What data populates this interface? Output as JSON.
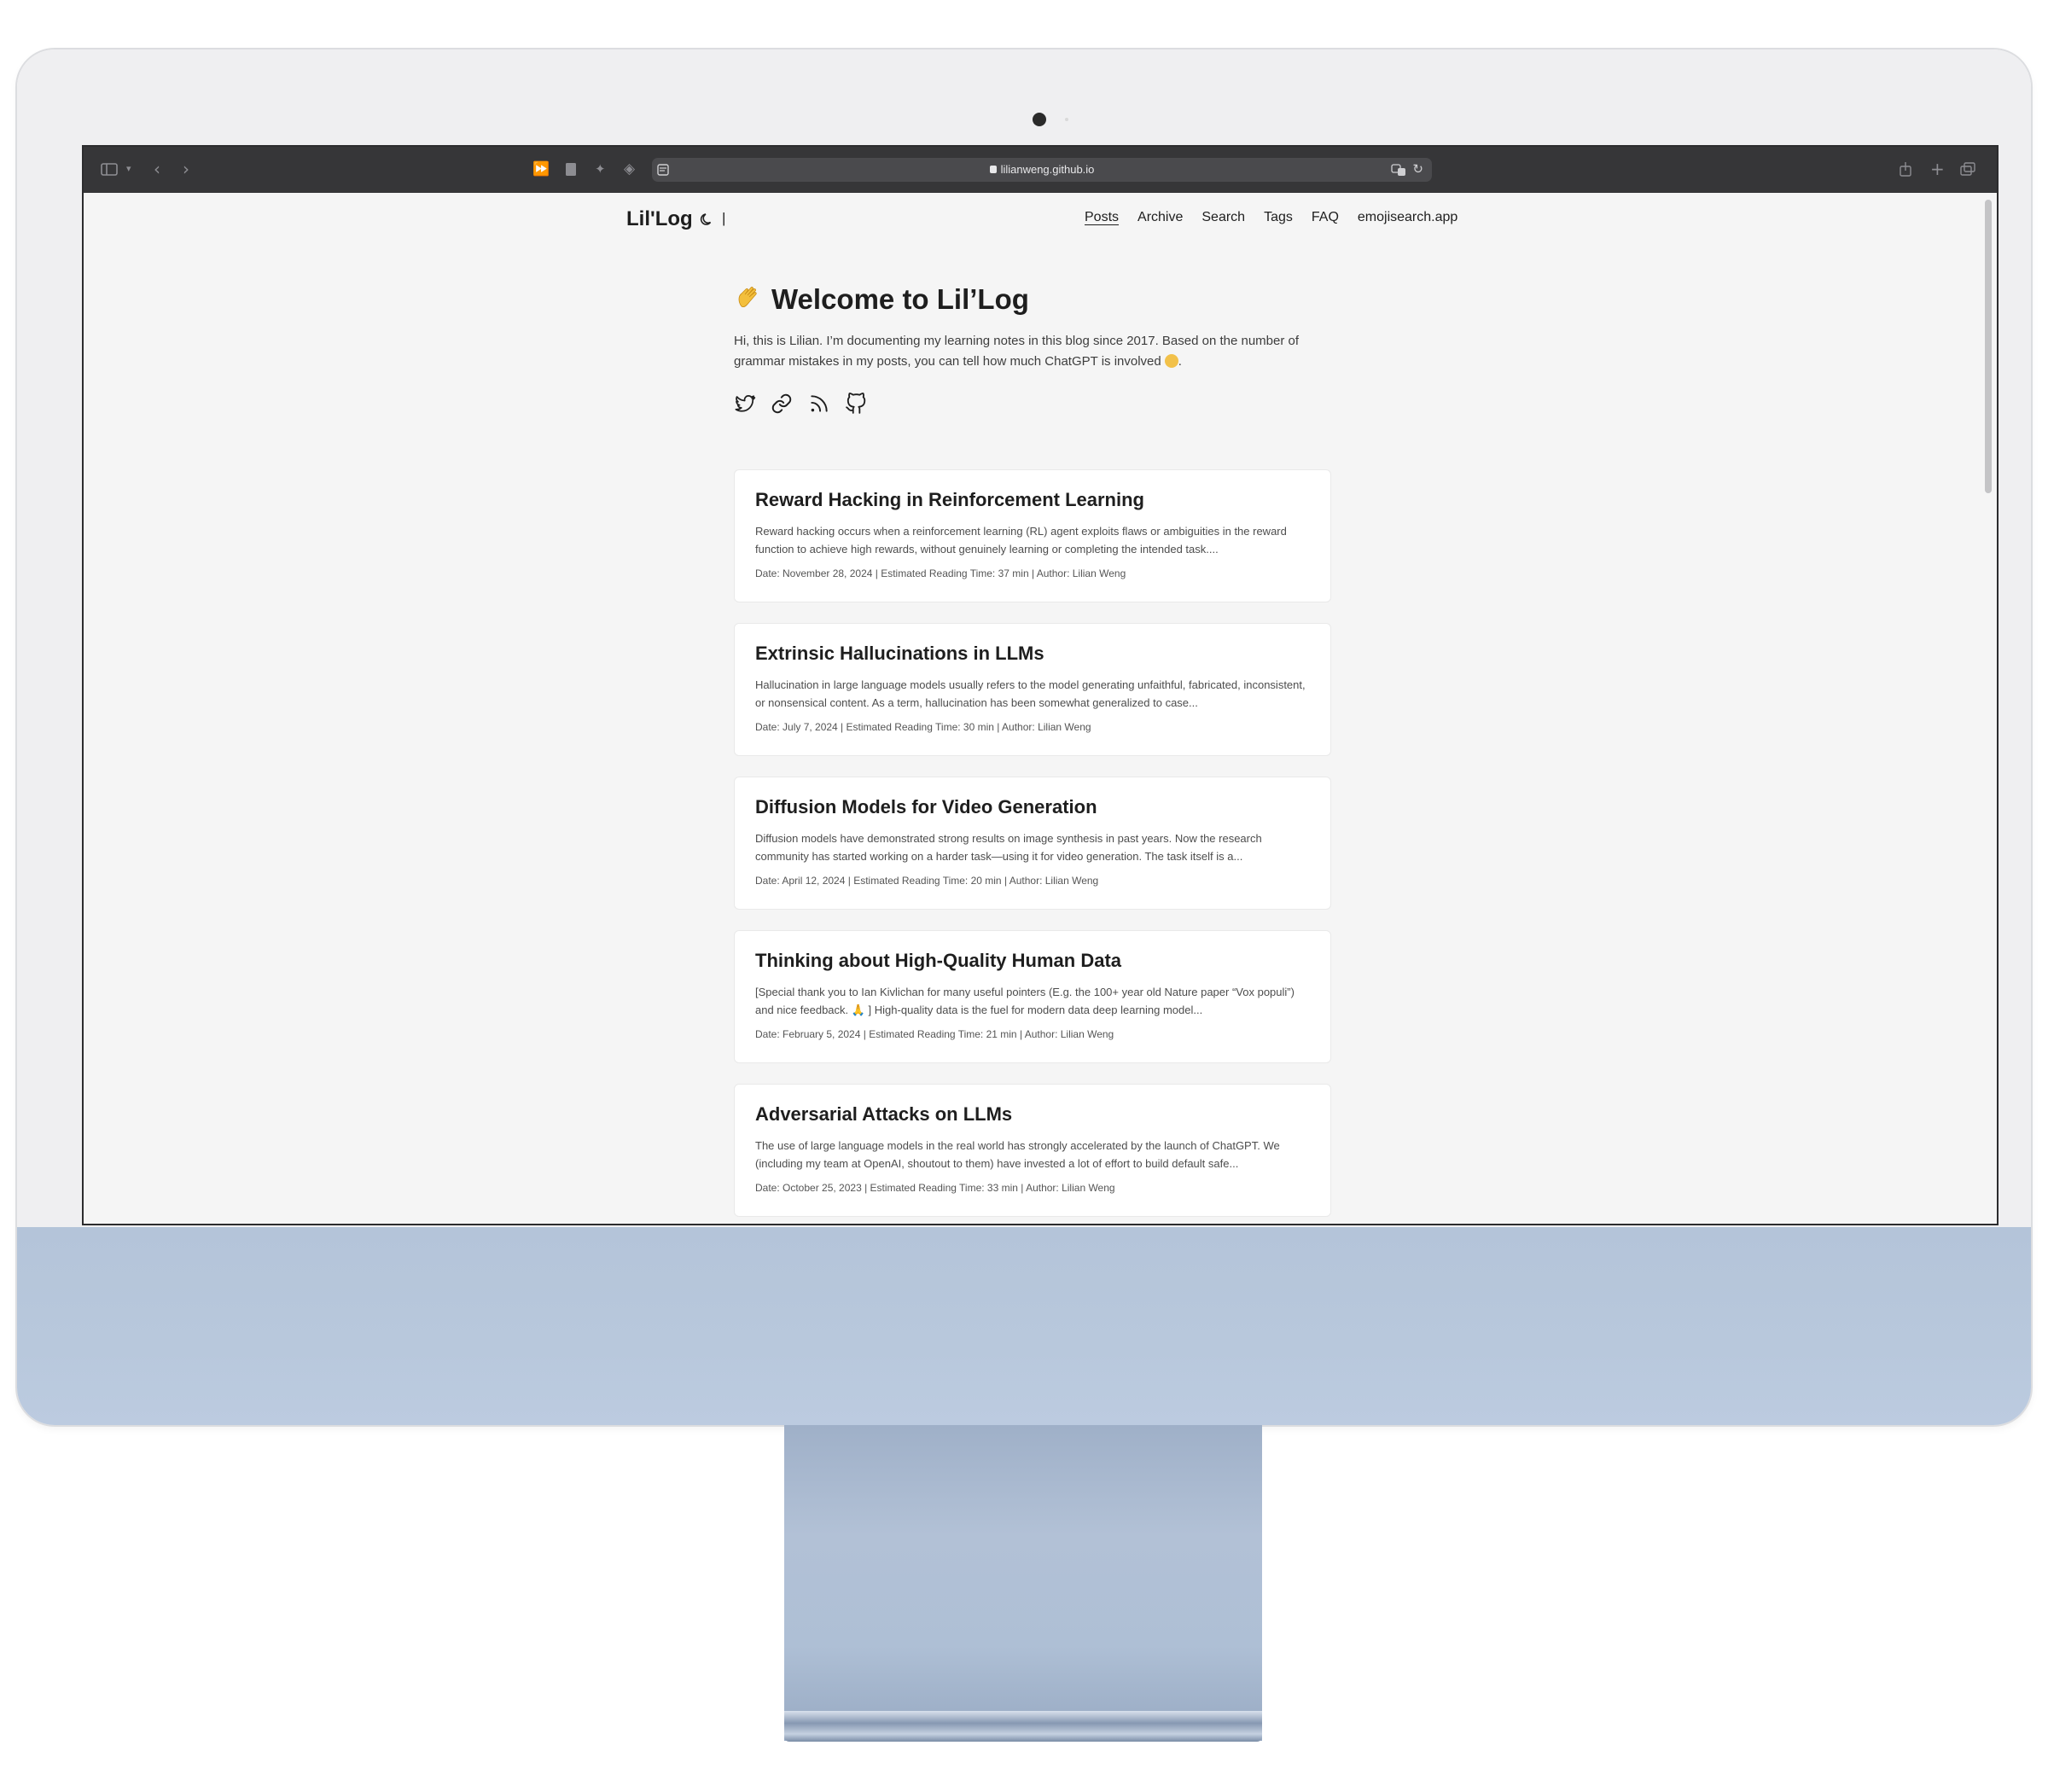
{
  "browser": {
    "url": "lilianweng.github.io"
  },
  "site": {
    "logo": "Lil'Log",
    "separator": "|",
    "menu": [
      {
        "label": "Posts",
        "active": true
      },
      {
        "label": "Archive",
        "active": false
      },
      {
        "label": "Search",
        "active": false
      },
      {
        "label": "Tags",
        "active": false
      },
      {
        "label": "FAQ",
        "active": false
      },
      {
        "label": "emojisearch.app",
        "active": false
      }
    ]
  },
  "hero": {
    "title": "Welcome to Lil’Log",
    "intro": "Hi, this is Lilian. I’m documenting my learning notes in this blog since 2017. Based on the number of grammar mistakes in my posts, you can tell how much ChatGPT is involved",
    "intro_end": ".",
    "socials": [
      "twitter-icon",
      "link-icon",
      "rss-icon",
      "github-icon"
    ]
  },
  "posts": [
    {
      "title": "Reward Hacking in Reinforcement Learning",
      "summary": "Reward hacking occurs when a reinforcement learning (RL) agent exploits flaws or ambiguities in the reward function to achieve high rewards, without genuinely learning or completing the intended task....",
      "meta": "Date: November 28, 2024 | Estimated Reading Time: 37 min | Author: Lilian Weng"
    },
    {
      "title": "Extrinsic Hallucinations in LLMs",
      "summary": "Hallucination in large language models usually refers to the model generating unfaithful, fabricated, inconsistent, or nonsensical content. As a term, hallucination has been somewhat generalized to case...",
      "meta": "Date: July 7, 2024 | Estimated Reading Time: 30 min | Author: Lilian Weng"
    },
    {
      "title": "Diffusion Models for Video Generation",
      "summary": "Diffusion models have demonstrated strong results on image synthesis in past years. Now the research community has started working on a harder task—using it for video generation. The task itself is a...",
      "meta": "Date: April 12, 2024 | Estimated Reading Time: 20 min | Author: Lilian Weng"
    },
    {
      "title": "Thinking about High-Quality Human Data",
      "summary": "[Special thank you to Ian Kivlichan for many useful pointers (E.g. the 100+ year old Nature paper “Vox populi”) and nice feedback. 🙏 ] High-quality data is the fuel for modern data deep learning model...",
      "meta": "Date: February 5, 2024 | Estimated Reading Time: 21 min | Author: Lilian Weng"
    },
    {
      "title": "Adversarial Attacks on LLMs",
      "summary": "The use of large language models in the real world has strongly accelerated by the launch of ChatGPT. We (including my team at OpenAI, shoutout to them) have invested a lot of effort to build default safe...",
      "meta": "Date: October 25, 2023 | Estimated Reading Time: 33 min | Author: Lilian Weng"
    }
  ]
}
